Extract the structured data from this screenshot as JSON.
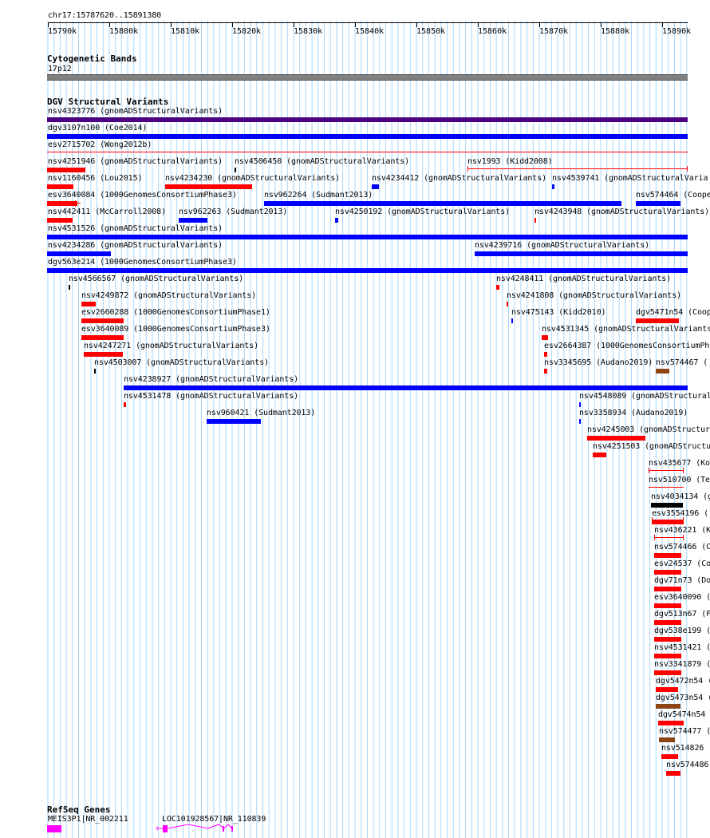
{
  "colors": {
    "blue": "#0000ff",
    "red": "#ff0000",
    "purple": "#4b0082",
    "brown": "#8b4513",
    "black": "#000000",
    "magenta": "#ff00ff",
    "grid": "#a7d7ff",
    "band": "#808080"
  },
  "ruler": {
    "title": "chr17:15787620..15891380",
    "ticks": [
      "15790k",
      "15800k",
      "15810k",
      "15820k",
      "15830k",
      "15840k",
      "15850k",
      "15860k",
      "15870k",
      "15880k",
      "15890k"
    ]
  },
  "cytoband": {
    "title": "Cytogenetic Bands",
    "band_label": "17p12"
  },
  "dgv": {
    "title": "DGV Structural Variants",
    "variants": [
      "nsv4323776 (gnomADStructuralVariants)",
      "dgv3107n100 (Coe2014)",
      "esv2715702 (Wong2012b)",
      "nsv4251946 (gnomADStructuralVariants)",
      "nsv4506450 (gnomADStructuralVariants)",
      "nsv1993 (Kidd2008)",
      "nsv1160456 (Lou2015)",
      "nsv4234230 (gnomADStructuralVariants)",
      "nsv4234412 (gnomADStructuralVariants)",
      "nsv4539741 (gnomADStructuralVaria",
      "esv3640084 (1000GenomesConsortiumPhase3)",
      "nsv962264 (Sudmant2013)",
      "nsv574464 (Coope",
      "nsv442411 (McCarroll2008)",
      "nsv962263 (Sudmant2013)",
      "nsv4250192 (gnomADStructuralVariants)",
      "nsv4243948 (gnomADStructuralVariants)",
      "nsv4531526 (gnomADStructuralVariants)",
      "nsv4234286 (gnomADStructuralVariants)",
      "nsv4239716 (gnomADStructuralVariants)",
      "dgv563e214 (1000GenomesConsortiumPhase3)",
      "nsv4566567 (gnomADStructuralVariants)",
      "nsv4248411 (gnomADStructuralVariants)",
      "nsv4249872 (gnomADStructuralVariants)",
      "nsv4241808 (gnomADStructuralVariants)",
      "esv2660288 (1000GenomesConsortiumPhase1)",
      "nsv475143 (Kidd2010)",
      "dgv5471n54 (Coop",
      "esv3640089 (1000GenomesConsortiumPhase3)",
      "nsv4531345 (gnomADStructuralVariants",
      "nsv4247271 (gnomADStructuralVariants)",
      "esv2664387 (1000GenomesConsortiumPh",
      "nsv4503007 (gnomADStructuralVariants)",
      "nsv3345695 (Audano2019)",
      "nsv574467 (",
      "nsv4238927 (gnomADStructuralVariants)",
      "nsv4531478 (gnomADStructuralVariants)",
      "nsv4548089 (gnomADStructural",
      "nsv960421 (Sudmant2013)",
      "nsv3358934 (Audano2019)",
      "nsv4245003 (gnomADStructur",
      "nsv4251503 (gnomADStructu",
      "nsv435677 (Ko",
      "nsv510700 (Te",
      "nsv4034134 (g",
      "esv3554196 (",
      "nsv436221 (K",
      "nsv574466 (C",
      "esv24537 (Co",
      "dgv71n73 (Do",
      "esv3640090 (",
      "dgv513n67 (F",
      "dgv538e199 (",
      "nsv4531421 (",
      "nsv3341879 (",
      "dgv5472n54 (",
      "dgv5473n54 (",
      "dgv5474n54",
      "nsv574477 (",
      "nsv514826",
      "nsv574486"
    ]
  },
  "refseq": {
    "title": "RefSeq Genes",
    "genes": [
      "MEIS3P1|NR_002211",
      "LOC101928567|NR_110839"
    ]
  }
}
